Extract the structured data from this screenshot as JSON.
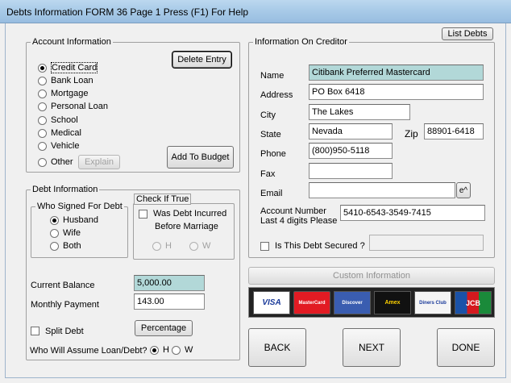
{
  "window": {
    "title": "Debts Information FORM  36  Page 1  Press (F1) For Help"
  },
  "account_info": {
    "legend": "Account Information",
    "types": [
      {
        "label": "Credit Card",
        "selected": true
      },
      {
        "label": "Bank Loan",
        "selected": false
      },
      {
        "label": "Mortgage",
        "selected": false
      },
      {
        "label": "Personal Loan",
        "selected": false
      },
      {
        "label": "School",
        "selected": false
      },
      {
        "label": "Medical",
        "selected": false
      },
      {
        "label": "Vehicle",
        "selected": false
      },
      {
        "label": "Other",
        "selected": false
      }
    ],
    "delete_label": "Delete Entry",
    "explain_label": "Explain",
    "add_budget_label": "Add To Budget"
  },
  "debt_info": {
    "legend": "Debt Information",
    "who_signed": {
      "legend": "Who Signed For Debt",
      "options": [
        {
          "label": "Husband",
          "selected": true
        },
        {
          "label": "Wife",
          "selected": false
        },
        {
          "label": "Both",
          "selected": false
        }
      ]
    },
    "check_if_true": {
      "legend": "Check If True",
      "label_line1": "Was Debt Incurred",
      "label_line2": "Before Marriage",
      "h": "H",
      "w": "W"
    },
    "current_balance_label": "Current Balance",
    "current_balance": "5,000.00",
    "monthly_payment_label": "Monthly Payment",
    "monthly_payment": "143.00",
    "split_debt_label": "Split Debt",
    "percentage_label": "Percentage",
    "assume_label": "Who Will Assume Loan/Debt?",
    "assume_h": "H",
    "assume_w": "W"
  },
  "creditor": {
    "list_debts_label": "List Debts",
    "legend": "Information On Creditor",
    "name_label": "Name",
    "name": "Citibank Preferred Mastercard",
    "address_label": "Address",
    "address": "PO Box 6418",
    "city_label": "City",
    "city": "The Lakes",
    "state_label": "State",
    "state": "Nevada",
    "zip_label": "Zip",
    "zip": "88901-6418",
    "phone_label": "Phone",
    "phone": "(800)950-5118",
    "fax_label": "Fax",
    "fax": "",
    "email_label": "Email",
    "email": "",
    "email_btn": "e^",
    "account_label_line1": "Account Number",
    "account_label_line2": "Last 4 digits Please",
    "account_number": "5410-6543-3549-7415",
    "secured_label": "Is This Debt Secured ?",
    "custom_info_label": "Custom Information"
  },
  "cards": [
    "VISA",
    "MasterCard",
    "Discover",
    "Amex",
    "Diners Club",
    "JCB"
  ],
  "nav": {
    "back": "BACK",
    "next": "NEXT",
    "done": "DONE"
  }
}
